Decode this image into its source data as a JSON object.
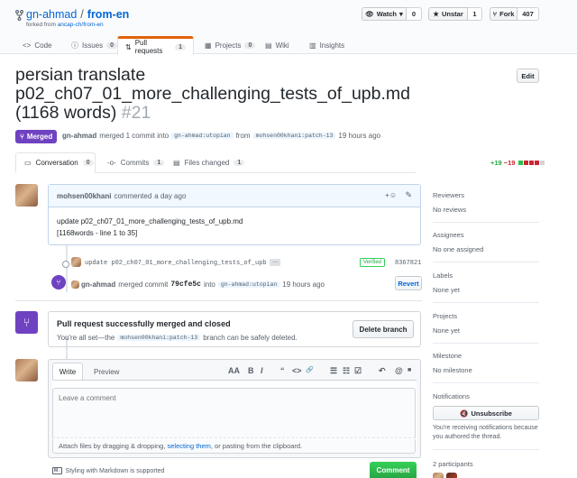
{
  "repo": {
    "owner": "gn-ahmad",
    "separator": "/",
    "name": "from-en",
    "forked_prefix": "forked from",
    "forked_from": "ancap-ch/from-en"
  },
  "actions": {
    "watch_label": "Watch",
    "watch_count": "0",
    "unstar_label": "Unstar",
    "star_count": "1",
    "fork_label": "Fork",
    "fork_count": "407"
  },
  "repo_tabs": [
    {
      "label": "Code",
      "count": ""
    },
    {
      "label": "Issues",
      "count": "0"
    },
    {
      "label": "Pull requests",
      "count": "1"
    },
    {
      "label": "Projects",
      "count": "0"
    },
    {
      "label": "Wiki",
      "count": ""
    },
    {
      "label": "Insights",
      "count": ""
    }
  ],
  "pr": {
    "title": "persian translate p02_ch07_01_more_challenging_tests_of_upb.md (1168 words)",
    "number": "#21",
    "edit_label": "Edit",
    "state": "Merged",
    "author": "gn-ahmad",
    "merged_text": "merged 1 commit into",
    "base_branch": "gn-ahmad:utopian",
    "from_text": "from",
    "head_branch": "mohsen00khani:patch-13",
    "time": "19 hours ago"
  },
  "pr_tabs": [
    {
      "label": "Conversation",
      "count": "0"
    },
    {
      "label": "Commits",
      "count": "1"
    },
    {
      "label": "Files changed",
      "count": "1"
    }
  ],
  "diffstat": {
    "additions": "+19",
    "deletions": "−19",
    "colors": [
      "#2cbe4e",
      "#cb2431",
      "#cb2431",
      "#cb2431",
      "#d1d5da"
    ]
  },
  "comment": {
    "author": "mohsen00khani",
    "action": "commented",
    "time": "a day ago",
    "body_line1": "update p02_ch07_01_more_challenging_tests_of_upb.md",
    "body_line2": "[1168words - line 1 to 35]"
  },
  "commit": {
    "message": "update p02_ch07_01_more_challenging_tests_of_upb",
    "ellipsis": "…",
    "verified": "Verified",
    "sha": "8367821"
  },
  "merge_event": {
    "author": "gn-ahmad",
    "text": "merged commit",
    "sha": "79cfe5c",
    "into": "into",
    "branch": "gn-ahmad:utopian",
    "time": "19 hours ago",
    "revert_label": "Revert"
  },
  "merged_box": {
    "title": "Pull request successfully merged and closed",
    "text_before": "You're all set—the",
    "branch": "mohsen00khani:patch-13",
    "text_after": "branch can be safely deleted.",
    "delete_label": "Delete branch"
  },
  "editor": {
    "write_tab": "Write",
    "preview_tab": "Preview",
    "placeholder": "Leave a comment",
    "attach_before": "Attach files by dragging & dropping,",
    "attach_link": "selecting them",
    "attach_after": ", or pasting from the clipboard.",
    "markdown_note": "Styling with Markdown is supported",
    "submit_label": "Comment",
    "toolbar": {
      "heading": "AA",
      "bold": "B",
      "italic": "I",
      "quote": "“",
      "code": "<>",
      "link": "🔗",
      "ul": "☰",
      "ol": "☷",
      "task": "☑",
      "reply": "↶",
      "mention": "@",
      "bookmark": "■"
    }
  },
  "sidebar": {
    "reviewers_h": "Reviewers",
    "reviewers_v": "No reviews",
    "assignees_h": "Assignees",
    "assignees_v": "No one assigned",
    "labels_h": "Labels",
    "labels_v": "None yet",
    "projects_h": "Projects",
    "projects_v": "None yet",
    "milestone_h": "Milestone",
    "milestone_v": "No milestone",
    "notifications_h": "Notifications",
    "unsubscribe_label": "Unsubscribe",
    "notify_text_1": "You're receiving notifications because",
    "notify_text_2": "you authored the thread.",
    "participants": "2 participants"
  }
}
